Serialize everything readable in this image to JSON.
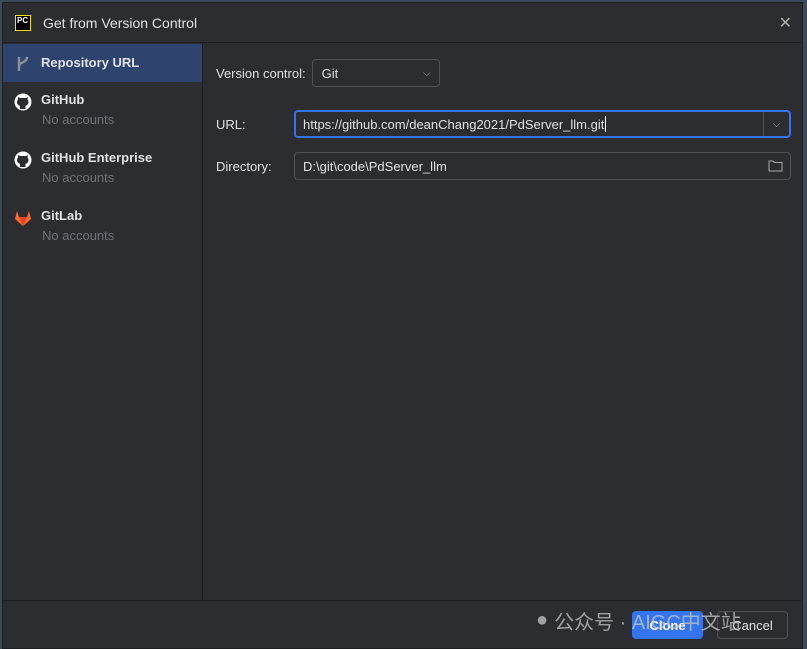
{
  "window": {
    "title": "Get from Version Control",
    "logo_text": "PC"
  },
  "sidebar": {
    "items": [
      {
        "label": "Repository URL",
        "icon": "vcs-branch-icon"
      },
      {
        "label": "GitHub",
        "sub": "No accounts",
        "icon": "github-icon"
      },
      {
        "label": "GitHub Enterprise",
        "sub": "No accounts",
        "icon": "github-icon"
      },
      {
        "label": "GitLab",
        "sub": "No accounts",
        "icon": "gitlab-icon"
      }
    ]
  },
  "form": {
    "vcs_label": "Version control:",
    "vcs_value": "Git",
    "url_label": "URL:",
    "url_value": "https://github.com/deanChang2021/PdServer_llm.git",
    "dir_label": "Directory:",
    "dir_value": "D:\\git\\code\\PdServer_llm"
  },
  "footer": {
    "clone": "Clone",
    "cancel": "Cancel"
  },
  "watermark": "公众号 · AIGC中文站",
  "colors": {
    "accent": "#3574f0",
    "selected": "#2e436e",
    "background": "#2b2d30"
  }
}
